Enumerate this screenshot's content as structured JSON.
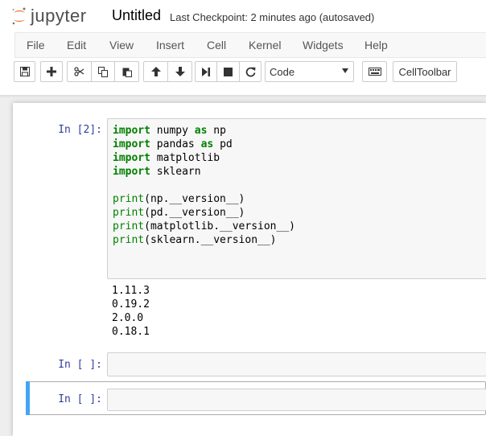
{
  "header": {
    "logo_text": "jupyter",
    "notebook_title": "Untitled",
    "checkpoint": "Last Checkpoint: 2 minutes ago (autosaved)"
  },
  "menu": [
    "File",
    "Edit",
    "View",
    "Insert",
    "Cell",
    "Kernel",
    "Widgets",
    "Help"
  ],
  "toolbar": {
    "cell_type": "Code",
    "celltoolbar_label": "CellToolbar"
  },
  "cells": [
    {
      "prompt": "In [2]:",
      "code": [
        [
          {
            "t": "import",
            "c": "kw"
          },
          {
            "t": " numpy "
          },
          {
            "t": "as",
            "c": "kw"
          },
          {
            "t": " np"
          }
        ],
        [
          {
            "t": "import",
            "c": "kw"
          },
          {
            "t": " pandas "
          },
          {
            "t": "as",
            "c": "kw"
          },
          {
            "t": " pd"
          }
        ],
        [
          {
            "t": "import",
            "c": "kw"
          },
          {
            "t": " matplotlib"
          }
        ],
        [
          {
            "t": "import",
            "c": "kw"
          },
          {
            "t": " sklearn"
          }
        ],
        [],
        [
          {
            "t": "print",
            "c": "bi"
          },
          {
            "t": "(np.__version__)"
          }
        ],
        [
          {
            "t": "print",
            "c": "bi"
          },
          {
            "t": "(pd.__version__)"
          }
        ],
        [
          {
            "t": "print",
            "c": "bi"
          },
          {
            "t": "(matplotlib.__version__)"
          }
        ],
        [
          {
            "t": "print",
            "c": "bi"
          },
          {
            "t": "(sklearn.__version__)"
          }
        ]
      ],
      "output": [
        "1.11.3",
        "0.19.2",
        "2.0.0",
        "0.18.1"
      ]
    },
    {
      "prompt": "In [ ]:"
    },
    {
      "prompt": "In [ ]:"
    }
  ],
  "colors": {
    "prompt_in": "#303f9f",
    "keyword": "#008000",
    "selected_bar": "#42a5f5"
  }
}
